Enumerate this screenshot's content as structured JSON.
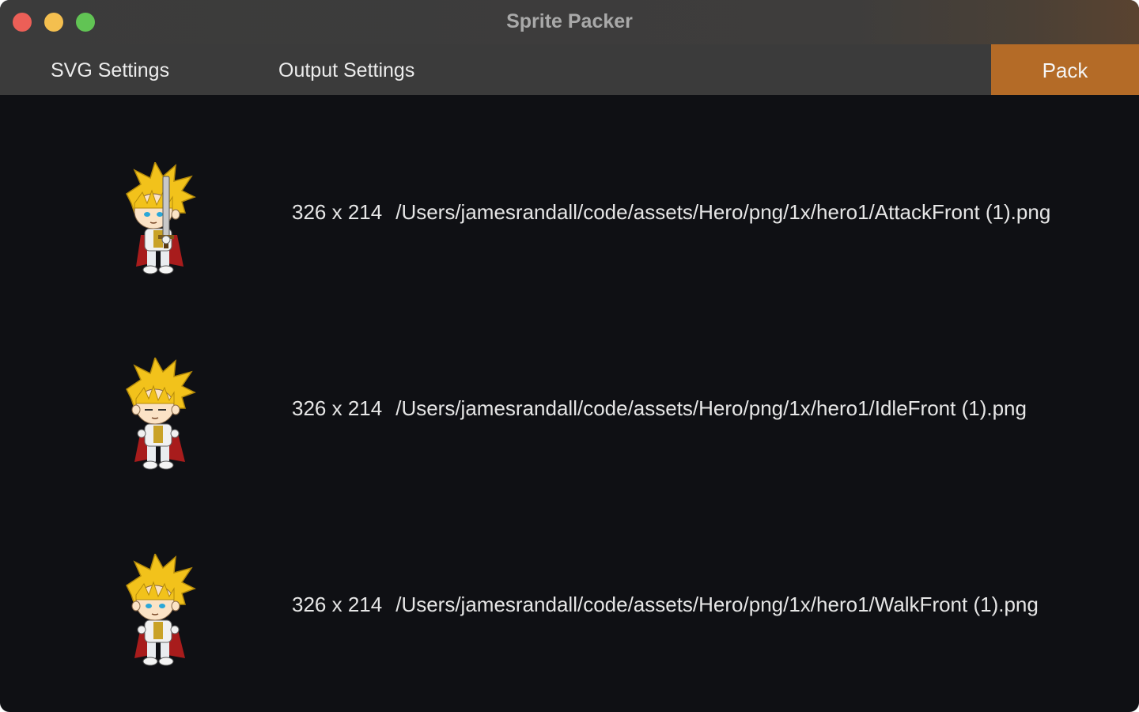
{
  "window": {
    "title": "Sprite Packer"
  },
  "toolbar": {
    "svg_settings_label": "SVG Settings",
    "output_settings_label": "Output Settings",
    "pack_label": "Pack",
    "pack_color": "#b46b27"
  },
  "sprites": [
    {
      "dimensions": "326 x 214",
      "path": "/Users/jamesrandall/code/assets/Hero/png/1x/hero1/AttackFront (1).png",
      "thumbnail": "hero-attack-sprite"
    },
    {
      "dimensions": "326 x 214",
      "path": "/Users/jamesrandall/code/assets/Hero/png/1x/hero1/IdleFront (1).png",
      "thumbnail": "hero-idle-sprite"
    },
    {
      "dimensions": "326 x 214",
      "path": "/Users/jamesrandall/code/assets/Hero/png/1x/hero1/WalkFront (1).png",
      "thumbnail": "hero-walk-sprite"
    }
  ]
}
